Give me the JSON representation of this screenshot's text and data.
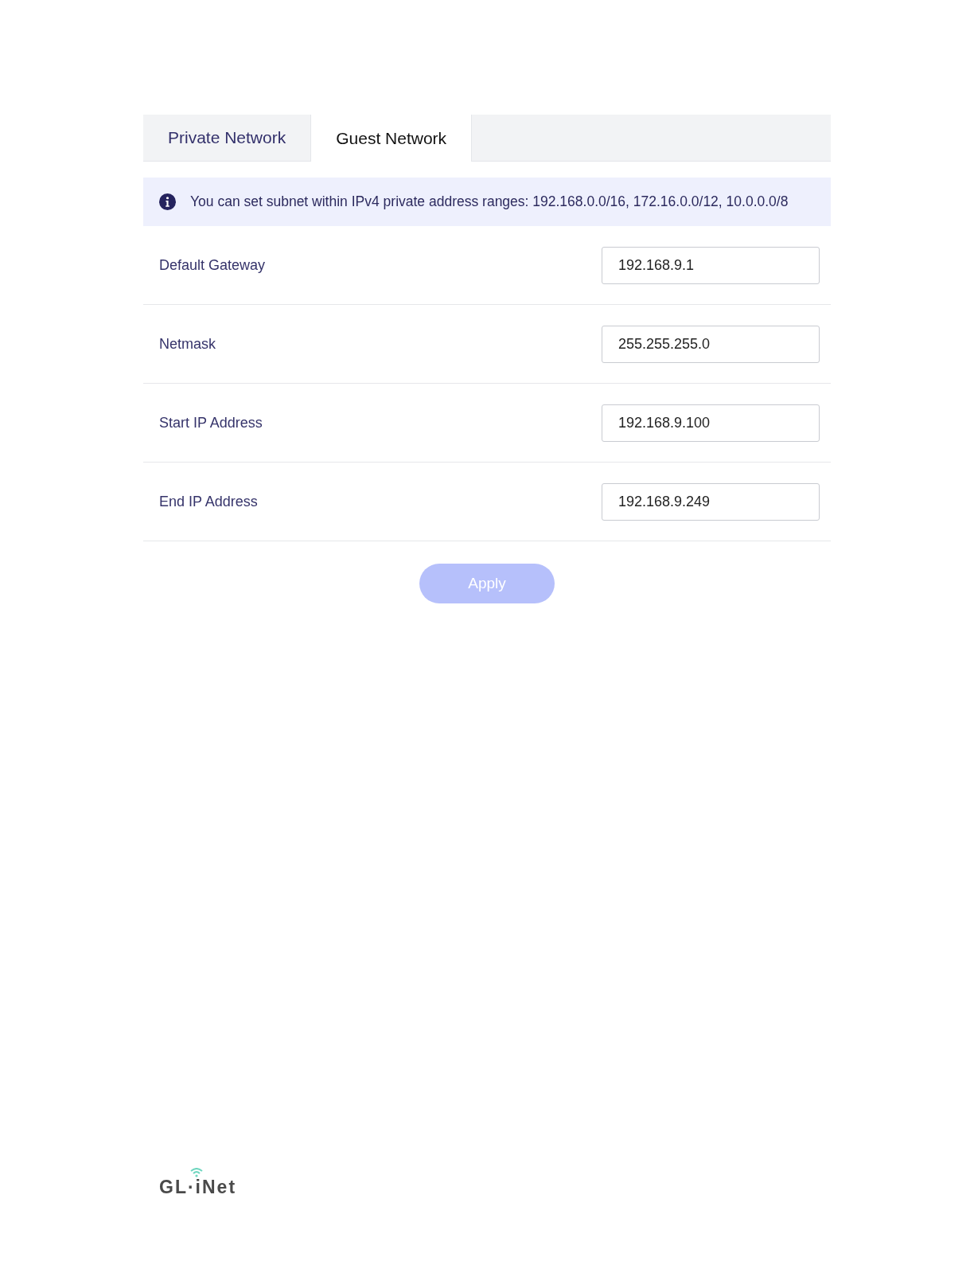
{
  "tabs": [
    {
      "label": "Private Network",
      "selected": false
    },
    {
      "label": "Guest Network",
      "selected": true
    }
  ],
  "notice": {
    "text": "You can set subnet within IPv4 private address ranges: 192.168.0.0/16, 172.16.0.0/12, 10.0.0.0/8"
  },
  "fields": [
    {
      "label": "Default Gateway",
      "value": "192.168.9.1"
    },
    {
      "label": "Netmask",
      "value": "255.255.255.0"
    },
    {
      "label": "Start IP Address",
      "value": "192.168.9.100"
    },
    {
      "label": "End IP Address",
      "value": "192.168.9.249"
    }
  ],
  "apply_button": {
    "label": "Apply",
    "disabled": true
  },
  "footer": {
    "logo_text": "GL·iNet"
  }
}
